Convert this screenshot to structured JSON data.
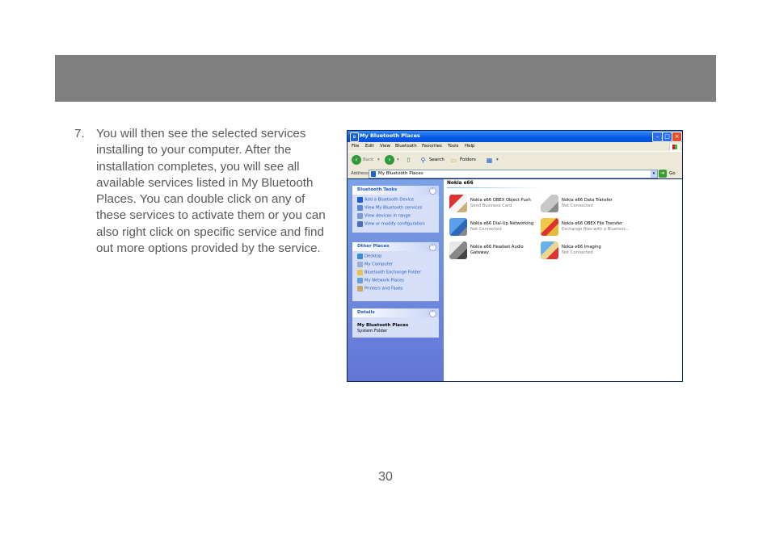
{
  "step": {
    "number": "7.",
    "text": "You will then see the selected services installing to your computer.  After the installation completes, you will see all available services listed in My Bluetooth Places.  You can double click on any of these services to activate them or you can also right click on specific service and find out more options provided by the service."
  },
  "page_number": "30",
  "window": {
    "title": "My Bluetooth Places",
    "menu": [
      "File",
      "Edit",
      "View",
      "Bluetooth",
      "Favorites",
      "Tools",
      "Help"
    ],
    "toolbar": {
      "back": "Back",
      "search": "Search",
      "folders": "Folders"
    },
    "address": {
      "label": "Address",
      "value": "My Bluetooth Places",
      "go": "Go"
    },
    "bluetooth_tasks": {
      "title": "Bluetooth Tasks",
      "items": [
        "Add a Bluetooth Device",
        "View My Bluetooth services",
        "View devices in range",
        "View or modify configuration"
      ]
    },
    "other_places": {
      "title": "Other Places",
      "items": [
        "Desktop",
        "My Computer",
        "Bluetooth Exchange Folder",
        "My Network Places",
        "Printers and Faxes"
      ]
    },
    "details": {
      "title": "Details",
      "name": "My Bluetooth Places",
      "type": "System Folder"
    },
    "group": "Nokia e66",
    "services": [
      {
        "name": "Nokia e66 OBEX Object Push",
        "status": "Send Business Card",
        "icon": "object-push-icon"
      },
      {
        "name": "Nokia e66 Data Transfer",
        "status": "Not Connected",
        "icon": "data-transfer-icon"
      },
      {
        "name": "Nokia e66 Dial-Up Networking",
        "status": "Not Connected",
        "icon": "dialup-icon"
      },
      {
        "name": "Nokia e66 OBEX File Transfer",
        "status": "Exchange files with a Bluetoot...",
        "icon": "file-transfer-icon"
      },
      {
        "name": "Nokia e66 Headset Audio Gateway",
        "status": "",
        "icon": "headset-icon"
      },
      {
        "name": "Nokia e66 Imaging",
        "status": "Not Connected",
        "icon": "imaging-icon"
      }
    ]
  },
  "colors": {
    "banner": "#808080",
    "body_text": "#58595b",
    "xp_blue": "#0058e6",
    "link_blue": "#215dc6"
  }
}
